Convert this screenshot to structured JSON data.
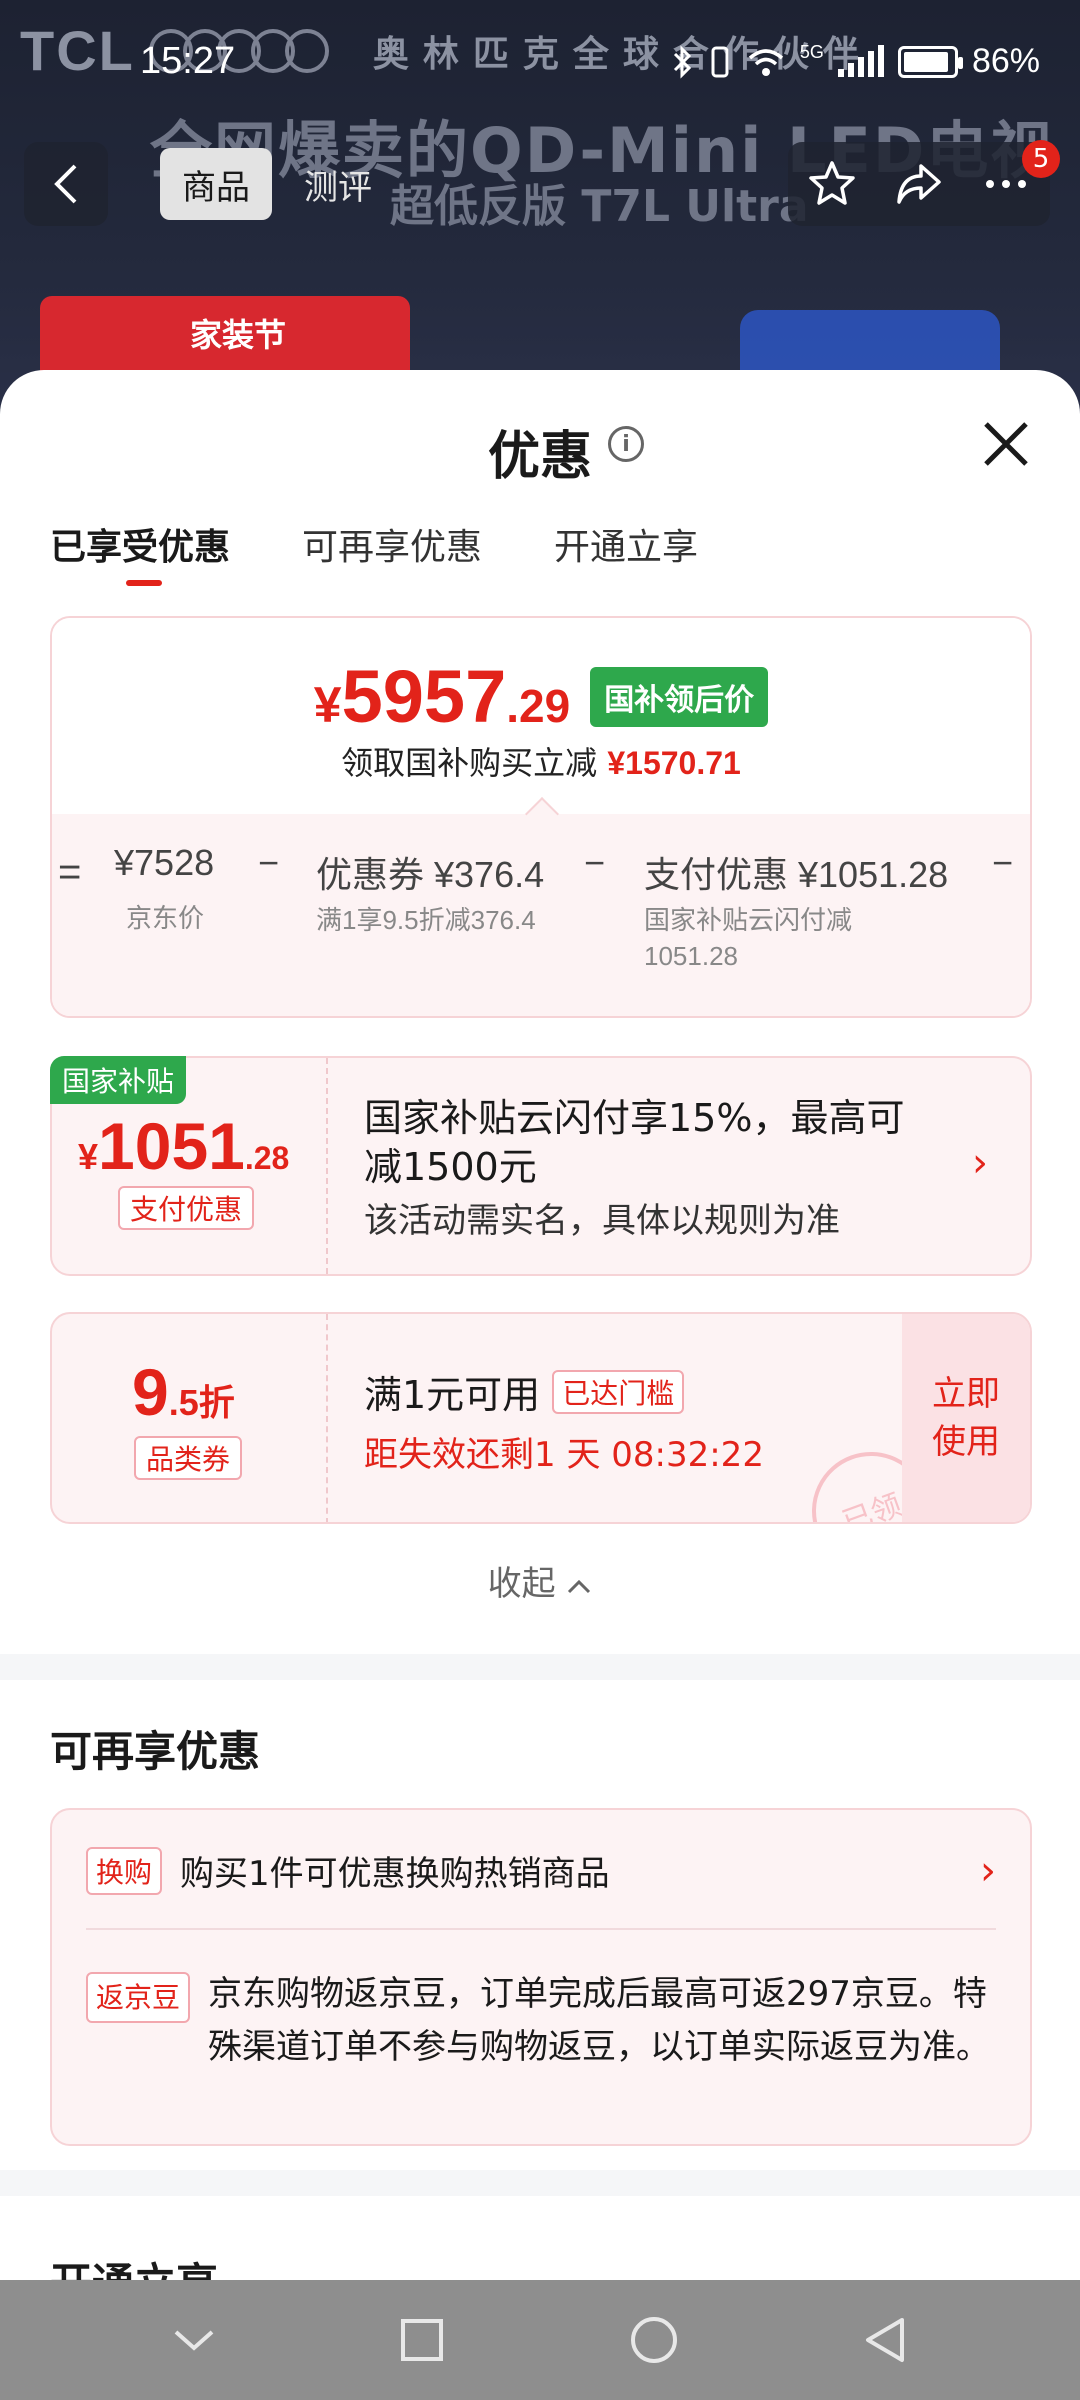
{
  "background": {
    "brand": "TCL",
    "partner_text": "奥林匹克全球合作伙伴",
    "headline": "全网爆卖的QD-Mini LED电视",
    "subheadline": "超低反版 T7L Ultra",
    "promo_label": "家装节"
  },
  "status_bar": {
    "time": "15:27",
    "battery": "86%",
    "network": "5G"
  },
  "top_nav": {
    "tabs": [
      "商品",
      "测评"
    ],
    "active_tab": 0,
    "badge_count": "5"
  },
  "sheet": {
    "title": "优惠",
    "tabs": [
      "已享受优惠",
      "可再享优惠",
      "开通立享"
    ],
    "active_tab": 0,
    "price_summary": {
      "yen": "¥",
      "price_int": "5957",
      "price_dec": ".29",
      "badge": "国补领后价",
      "sub_text": "领取国补购买立减",
      "sub_amount": "¥1570.71",
      "formula": {
        "equals": "=",
        "base_price": "¥7528",
        "base_label": "京东价",
        "minus1": "−",
        "coupon_label": "优惠券 ¥376.4",
        "coupon_desc": "满1享9.5折减376.4",
        "minus2": "−",
        "pay_label": "支付优惠 ¥1051.28",
        "pay_desc_line1": "国家补贴云闪付减",
        "pay_desc_line2": "1051.28",
        "minus3": "−"
      }
    },
    "subsidy_card": {
      "tag": "国家补贴",
      "yen": "¥",
      "amount_int": "1051",
      "amount_dec": ".28",
      "type_label": "支付优惠",
      "title": "国家补贴云闪付享15%，最高可减1500元",
      "desc": "该活动需实名，具体以规则为准"
    },
    "coupon_card": {
      "discount_int": "9",
      "discount_dec": ".5折",
      "type_label": "品类券",
      "condition": "满1元可用",
      "threshold_tag": "已达门槛",
      "expiry": "距失效还剩1 天 08:32:22",
      "action": "立即使用",
      "stamp": "已领"
    },
    "collapse_label": "收起",
    "more_section": {
      "title": "可再享优惠",
      "items": [
        {
          "tag": "换购",
          "text": "购买1件可优惠换购热销商品"
        },
        {
          "tag": "返京豆",
          "text": "京东购物返京豆，订单完成后最高可返297京豆。特殊渠道订单不参与购物返豆，以订单实际返豆为准。"
        }
      ]
    },
    "next_section_title": "开通立享"
  },
  "colors": {
    "accent_red": "#e2231a",
    "gov_green": "#2ea84c",
    "card_pink": "#fdf3f4"
  }
}
